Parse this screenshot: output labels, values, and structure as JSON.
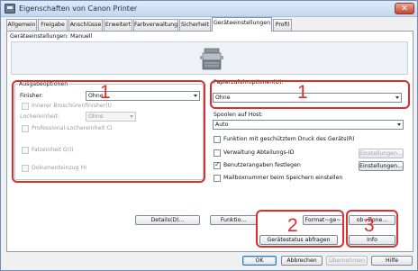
{
  "window": {
    "title": "Eigenschaften von Canon Printer",
    "close": "✕"
  },
  "tabs": [
    {
      "label": "Allgemein"
    },
    {
      "label": "Freigabe"
    },
    {
      "label": "Anschlüsse"
    },
    {
      "label": "Erweitert"
    },
    {
      "label": "Farbverwaltung"
    },
    {
      "label": "Sicherheit"
    },
    {
      "label": "Geräteeinstellungen"
    },
    {
      "label": "Profil"
    }
  ],
  "device_settings_label": "Geräteeinstellungen: Manuell",
  "output": {
    "group_title": "Ausgabeoptionen",
    "finisher_label": "Finisher:",
    "finisher_value": "Ohne",
    "inner_booklet": "Innerer Broschürenfinisher(I)",
    "punch_label": "Lochereinheit:",
    "punch_value": "Ohne",
    "pro_punch": "Professional-Lochereinheit CI",
    "fold_unit": "Falzeinheit G(I)",
    "doc_insert": "Dokumenteinzug HI"
  },
  "paper": {
    "group_title": "Papierzufuhroptionen(U):",
    "value": "Ohne"
  },
  "spool": {
    "label": "Spoolen auf Host:",
    "value": "Auto"
  },
  "options": {
    "secured_print": "Funktion mit geschütztem Druck des Geräts(R)",
    "dept_id": "Verwaltung Abteilungs-ID",
    "user_info": "Benutzerangaben festlegen",
    "mailbox": "Mailboxnummer beim Speichern einstellen",
    "settings_btn_1": "Einstellungen...",
    "settings_btn_2": "Einstellungen..."
  },
  "bottom": {
    "details": "Details(D)...",
    "function": "Funktio...",
    "format": "Format~ge~",
    "ob_zone": "ob~Zone...",
    "get_status": "Gerätestatus abfragen",
    "info": "Info"
  },
  "dialog": {
    "ok": "OK",
    "cancel": "Abbrechen",
    "apply": "Übernehmen",
    "help": "Hilfe"
  },
  "callouts": [
    "1",
    "1",
    "2",
    "3"
  ],
  "colors": {
    "callout_red": "#d9302b",
    "panel_white": "#ffffff"
  }
}
